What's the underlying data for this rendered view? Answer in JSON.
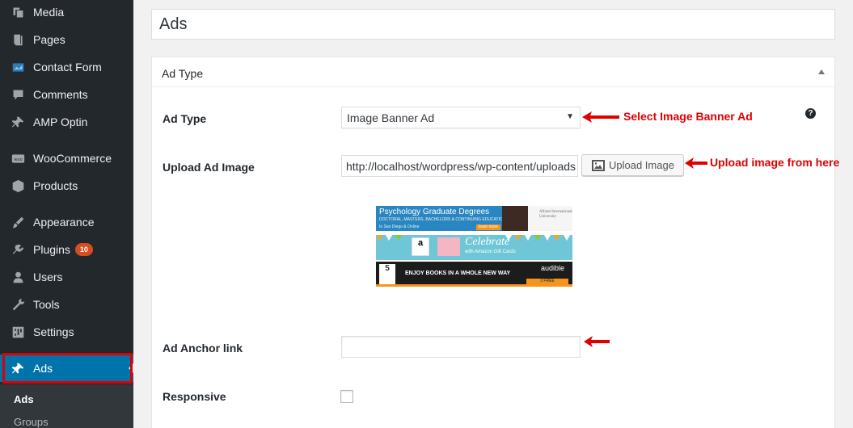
{
  "sidebar": {
    "items": [
      {
        "label": "Media",
        "icon": "media-icon",
        "badge": ""
      },
      {
        "label": "Pages",
        "icon": "pages-icon",
        "badge": ""
      },
      {
        "label": "Contact Form",
        "icon": "contact-form-icon",
        "badge": ""
      },
      {
        "label": "Comments",
        "icon": "comments-icon",
        "badge": ""
      },
      {
        "label": "AMP Optin",
        "icon": "pin-icon",
        "badge": ""
      },
      {
        "label": "WooCommerce",
        "icon": "woocommerce-icon",
        "badge": ""
      },
      {
        "label": "Products",
        "icon": "products-icon",
        "badge": ""
      },
      {
        "label": "Appearance",
        "icon": "appearance-icon",
        "badge": ""
      },
      {
        "label": "Plugins",
        "icon": "plugins-icon",
        "badge": "10"
      },
      {
        "label": "Users",
        "icon": "users-icon",
        "badge": ""
      },
      {
        "label": "Tools",
        "icon": "tools-icon",
        "badge": ""
      },
      {
        "label": "Settings",
        "icon": "settings-icon",
        "badge": ""
      },
      {
        "label": "Ads",
        "icon": "pin-icon",
        "badge": ""
      }
    ],
    "submenu": [
      "Ads",
      "Groups"
    ],
    "colors": {
      "bg": "#23282d",
      "active": "#0073aa",
      "highlight": "#e00000"
    }
  },
  "title": {
    "value": "Ads"
  },
  "metabox": {
    "title": "Ad Type",
    "fields": {
      "ad_type": {
        "label": "Ad Type",
        "value": "Image Banner Ad",
        "help": "?"
      },
      "upload": {
        "label": "Upload Ad Image",
        "value": "http://localhost/wordpress/wp-content/uploads",
        "button": "Upload Image"
      },
      "anchor": {
        "label": "Ad Anchor link",
        "value": ""
      },
      "responsive": {
        "label": "Responsive",
        "checked": false
      }
    },
    "banners": {
      "b1": {
        "title": "Psychology Graduate Degrees",
        "sub": "DOCTORAL, MASTERS, BACHELORS & CONTINUING EDUCATION",
        "loc": "In San Diego & Online",
        "cta": "learn more",
        "org": "Alliant International University"
      },
      "b2": {
        "logo": "a",
        "title": "Celebrate",
        "sub": "with Amazon Gift Cards"
      },
      "b3": {
        "badge": "5",
        "text": "ENJOY BOOKS IN A WHOLE NEW WAY",
        "brand": "audible",
        "cta": "2 FREE AUDIOBOOKS"
      }
    }
  },
  "annotations": {
    "select_note": "Select Image Banner Ad",
    "upload_note": "Upload image from here",
    "color": "#e00000"
  }
}
